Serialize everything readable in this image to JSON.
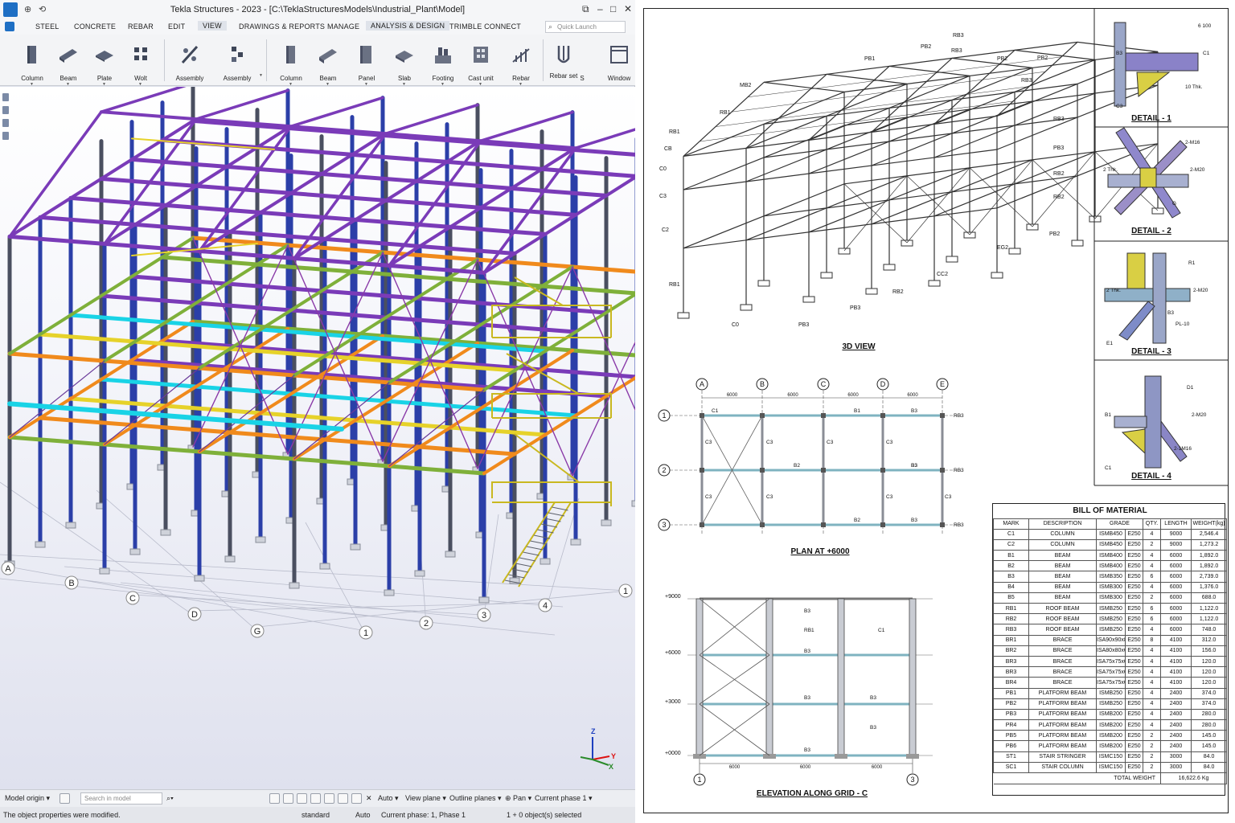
{
  "app": {
    "title": "Tekla Structures - 2023 - [C:\\TeklaStructuresModels\\Industrial_Plant\\Model]",
    "menu_tabs": [
      "STEEL",
      "CONCRETE",
      "REBAR",
      "EDIT",
      "VIEW",
      "DRAWINGS & REPORTS",
      "MANAGE",
      "ANALYSIS & DESIGN",
      "TRIMBLE CONNECT"
    ],
    "active_tab": "VIEW",
    "quick_launch_placeholder": "Quick Launch",
    "ribbon_steel": [
      "Column",
      "Beam",
      "Plate",
      "Wolt",
      "Assembly",
      "Assembly"
    ],
    "ribbon_concrete": [
      "Column",
      "Beam",
      "Panel",
      "Slab",
      "Footing",
      "Cast unit",
      "Rebar",
      "Rebar set",
      "S",
      "Window"
    ],
    "grid_letters": [
      "A",
      "B",
      "C",
      "D",
      "G"
    ],
    "grid_numbers": [
      "1",
      "2",
      "3",
      "4",
      "1"
    ],
    "axis": {
      "z": "Z",
      "y": "Y",
      "x": "X"
    }
  },
  "statusbar": {
    "model_origin": "Model origin",
    "search_placeholder": "Search in model",
    "auto": "Auto",
    "view_plane": "View plane",
    "outline_planes": "Outline planes",
    "pan": "Pan",
    "current_phase_short": "Current phase 1"
  },
  "messagebar": {
    "message": "The object properties were modified.",
    "standard": "standard",
    "auto": "Auto",
    "current_phase": "Current phase: 1, Phase 1",
    "selected": "1 + 0 object(s) selected"
  },
  "drawing": {
    "view3d_caption": "3D VIEW",
    "view3d_labels": [
      "RB3",
      "PB2",
      "PB1",
      "RB3",
      "PB2",
      "MB2",
      "RB1",
      "RB1",
      "CB",
      "C0",
      "C3",
      "C2",
      "RB1",
      "RB2",
      "PB3",
      "PB2",
      "PB3",
      "RB2",
      "CC2",
      "RB3",
      "PB3",
      "RB2",
      "C0",
      "PB2",
      "RB3",
      "EG2"
    ],
    "plan_caption": "PLAN AT +6000",
    "plan_grid_letters": [
      "A",
      "B",
      "C",
      "D",
      "E"
    ],
    "plan_grid_numbers": [
      "1",
      "2",
      "3"
    ],
    "plan_spacing": "6000",
    "plan_member_labels": [
      "C1",
      "B1",
      "B3",
      "RB3",
      "C3",
      "C3",
      "C3",
      "C3",
      "RB3",
      "B3",
      "B2",
      "B3",
      "C3",
      "C3",
      "C3",
      "C3",
      "RB3",
      "B2",
      "B3"
    ],
    "elevation_caption": "ELEVATION ALONG GRID - C",
    "elevation_levels": [
      "+9000",
      "+6000",
      "+3000",
      "+0000"
    ],
    "elevation_grid_numbers": [
      "1",
      "3"
    ],
    "elevation_spacing": "6000",
    "elevation_member_labels": [
      "B3",
      "RB1",
      "C1",
      "B3",
      "B3",
      "B3",
      "B3",
      "B3"
    ],
    "details": [
      {
        "caption": "DETAIL - 1",
        "labels": [
          "6 100",
          "C1",
          "B3",
          "10 Thk.",
          "C3"
        ]
      },
      {
        "caption": "DETAIL - 2",
        "labels": [
          "2-M16",
          "2-M20",
          "2 Thk.",
          "G"
        ]
      },
      {
        "caption": "DETAIL - 3",
        "labels": [
          "R1",
          "2-M20",
          "2 Thk.",
          "PL-10",
          "E1",
          "B3"
        ]
      },
      {
        "caption": "DETAIL - 4",
        "labels": [
          "D1",
          "2-M20",
          "B1",
          "2-1M16",
          "C1"
        ]
      }
    ]
  },
  "bom": {
    "title": "BILL OF MATERIAL",
    "headers": [
      "MARK",
      "DESCRIPTION",
      "GRADE",
      "",
      "QTY.",
      "LENGTH",
      "WEIGHT(kg)"
    ],
    "rows": [
      [
        "C1",
        "COLUMN",
        "ISMB450",
        "E250",
        "4",
        "9000",
        "2,546.4"
      ],
      [
        "C2",
        "COLUMN",
        "ISMB450",
        "E250",
        "2",
        "9000",
        "1,273.2"
      ],
      [
        "B1",
        "BEAM",
        "ISMB400",
        "E250",
        "4",
        "6000",
        "1,892.0"
      ],
      [
        "B2",
        "BEAM",
        "ISMB400",
        "E250",
        "4",
        "6000",
        "1,892.0"
      ],
      [
        "B3",
        "BEAM",
        "ISMB350",
        "E250",
        "6",
        "6000",
        "2,739.0"
      ],
      [
        "B4",
        "BEAM",
        "ISMB300",
        "E250",
        "4",
        "6000",
        "1,376.0"
      ],
      [
        "B5",
        "BEAM",
        "ISMB300",
        "E250",
        "2",
        "6000",
        "688.0"
      ],
      [
        "RB1",
        "ROOF BEAM",
        "ISMB250",
        "E250",
        "6",
        "6000",
        "1,122.0"
      ],
      [
        "RB2",
        "ROOF BEAM",
        "ISMB250",
        "E250",
        "6",
        "6000",
        "1,122.0"
      ],
      [
        "RB3",
        "ROOF BEAM",
        "ISMB250",
        "E250",
        "4",
        "6000",
        "748.0"
      ],
      [
        "BR1",
        "BRACE",
        "ISA90x90x8",
        "E250",
        "8",
        "4100",
        "312.0"
      ],
      [
        "BR2",
        "BRACE",
        "ISA80x80x6",
        "E250",
        "4",
        "4100",
        "156.0"
      ],
      [
        "BR3",
        "BRACE",
        "ISA75x75x6",
        "E250",
        "4",
        "4100",
        "120.0"
      ],
      [
        "BR3",
        "BRACE",
        "ISA75x75x6",
        "E250",
        "4",
        "4100",
        "120.0"
      ],
      [
        "BR4",
        "BRACE",
        "ISA75x75x6",
        "E250",
        "4",
        "4100",
        "120.0"
      ],
      [
        "PB1",
        "PLATFORM BEAM",
        "ISMB250",
        "E250",
        "4",
        "2400",
        "374.0"
      ],
      [
        "PB2",
        "PLATFORM BEAM",
        "ISMB250",
        "E250",
        "4",
        "2400",
        "374.0"
      ],
      [
        "PB3",
        "PLATFORM BEAM",
        "ISMB200",
        "E250",
        "4",
        "2400",
        "280.0"
      ],
      [
        "PR4",
        "PLATFORM BEAM",
        "ISMB200",
        "E250",
        "4",
        "2400",
        "280.0"
      ],
      [
        "PB5",
        "PLATFORM BEAM",
        "ISMB200",
        "E250",
        "2",
        "2400",
        "145.0"
      ],
      [
        "PB6",
        "PLATFORM BEAM",
        "ISMB200",
        "E250",
        "2",
        "2400",
        "145.0"
      ],
      [
        "ST1",
        "STAIR STRINGER",
        "ISMC150",
        "E250",
        "2",
        "3000",
        "84.0"
      ],
      [
        "SC1",
        "STAIR COLUMN",
        "ISMC150",
        "E250",
        "2",
        "3000",
        "84.0"
      ]
    ],
    "total_label": "TOTAL WEIGHT",
    "total_value": "16,622.6 Kg"
  },
  "colors": {
    "column_blue": "#2b3fa8",
    "beam_purple": "#7a3bb8",
    "beam_orange": "#f08a1c",
    "beam_yellow": "#e6d22a",
    "beam_green": "#7fb03a",
    "beam_cyan": "#19d3e6",
    "stair_yellow": "#e8d230",
    "ribbon_blue": "#1e6fc4"
  }
}
